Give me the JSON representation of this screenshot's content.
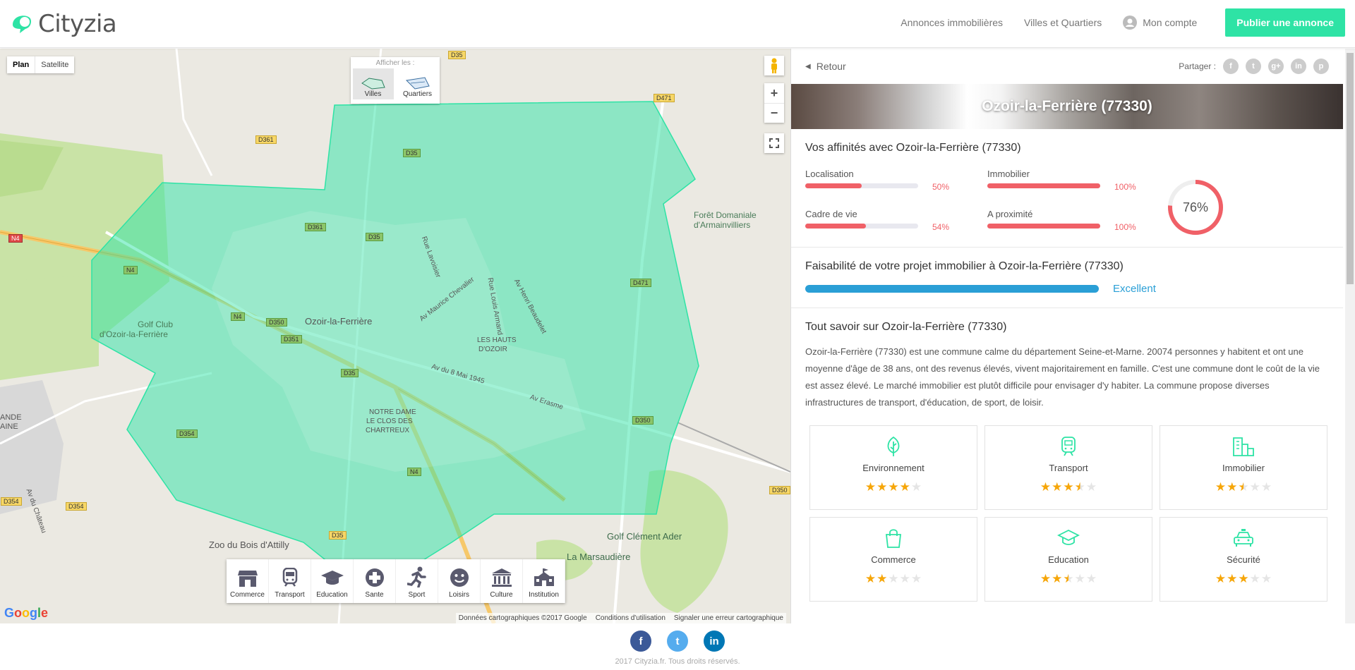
{
  "header": {
    "brand": "Cityzia",
    "nav": [
      "Annonces immobilières",
      "Villes et Quartiers"
    ],
    "account": "Mon compte",
    "publish": "Publier une annonce"
  },
  "map": {
    "type_plan": "Plan",
    "type_satellite": "Satellite",
    "show_title": "Afficher les :",
    "show_villes": "Villes",
    "show_quartiers": "Quartiers",
    "labels": {
      "city": "Ozoir-la-Ferrière",
      "forest1": "Forêt Domaniale",
      "forest2": "d'Armainvilliers",
      "golf1a": "Golf Club",
      "golf1b": "d'Ozoir-la-Ferrière",
      "hauts1": "LES HAUTS",
      "hauts2": "D'OZOIR",
      "nd1": "NOTRE DAME",
      "nd2": "LE CLOS DES",
      "nd3": "CHARTREUX",
      "zoo": "Zoo du Bois d'Attilly",
      "golf2": "Golf Clément Ader",
      "marsaudiere": "La Marsaudière",
      "av8mai": "Av du 8 Mai 1945",
      "averasme": "Av Erasme",
      "avmaurice": "Av Maurice Chevalier",
      "avhenri": "Av Henri Beaudelet",
      "avlouis": "Rue Louis Armand",
      "avvictor": "Rue Lavoisier",
      "avchateau": "Av du Château",
      "ande": "ANDE",
      "aine": "AINE"
    },
    "roads": [
      "D35",
      "D361",
      "D471",
      "D35",
      "D361",
      "D35",
      "N4",
      "N4",
      "D350",
      "D351",
      "N4",
      "D471",
      "D35",
      "D354",
      "D354",
      "D354",
      "D350",
      "N4",
      "D35",
      "D350"
    ],
    "poi": [
      {
        "label": "Commerce",
        "icon": "shop-icon"
      },
      {
        "label": "Transport",
        "icon": "train-icon"
      },
      {
        "label": "Education",
        "icon": "graduation-cap-icon"
      },
      {
        "label": "Sante",
        "icon": "medical-cross-icon"
      },
      {
        "label": "Sport",
        "icon": "runner-icon"
      },
      {
        "label": "Loisirs",
        "icon": "smiley-icon"
      },
      {
        "label": "Culture",
        "icon": "museum-icon"
      },
      {
        "label": "Institution",
        "icon": "town-hall-icon"
      }
    ],
    "footer": [
      "Données cartographiques ©2017 Google",
      "Conditions d'utilisation",
      "Signaler une erreur cartographique"
    ],
    "google": "Google",
    "polygon_color": "#2ee3a5"
  },
  "panel": {
    "back": "Retour",
    "share": "Partager :",
    "share_icons": [
      "facebook-icon",
      "twitter-icon",
      "google-plus-icon",
      "linkedin-icon",
      "pinterest-icon"
    ],
    "banner_title": "Ozoir-la-Ferrière (77330)",
    "affinities": {
      "title": "Vos affinités avec Ozoir-la-Ferrière (77330)",
      "items": [
        {
          "label": "Localisation",
          "pct": "50%",
          "value": 50
        },
        {
          "label": "Immobilier",
          "pct": "100%",
          "value": 100
        },
        {
          "label": "Cadre de vie",
          "pct": "54%",
          "value": 54
        },
        {
          "label": "A proximité",
          "pct": "100%",
          "value": 100
        }
      ],
      "total": "76%",
      "total_value": 76,
      "color": "#f06067"
    },
    "feasibility": {
      "title": "Faisabilité de votre projet immobilier à Ozoir-la-Ferrière (77330)",
      "value": "Excellent",
      "color": "#2a9fd6"
    },
    "about": {
      "title": "Tout savoir sur Ozoir-la-Ferrière (77330)",
      "text": "Ozoir-la-Ferrière (77330) est une commune calme du département Seine-et-Marne. 20074 personnes y habitent et ont une moyenne d'âge de 38 ans, ont des revenus élevés, vivent majoritairement en famille. C'est une commune dont le coût de la vie est assez élevé. Le marché immobilier est plutôt difficile pour envisager d'y habiter. La commune propose diverses infrastructures de transport, d'éducation, de sport, de loisir."
    },
    "cards": [
      {
        "title": "Environnement",
        "icon": "leaf-icon",
        "stars": 4
      },
      {
        "title": "Transport",
        "icon": "train-icon",
        "stars": 3.5
      },
      {
        "title": "Immobilier",
        "icon": "buildings-icon",
        "stars": 2.5
      },
      {
        "title": "Commerce",
        "icon": "shopping-bag-icon",
        "stars": 2
      },
      {
        "title": "Education",
        "icon": "graduation-cap-icon",
        "stars": 2.5
      },
      {
        "title": "Sécurité",
        "icon": "police-car-icon",
        "stars": 3
      }
    ],
    "accent": "#2ee3a5"
  },
  "footer": {
    "copy": "2017 Cityzia.fr. Tous droits réservés.",
    "socials": [
      {
        "name": "facebook-icon",
        "glyph": "f",
        "color": "#3b5998"
      },
      {
        "name": "twitter-icon",
        "glyph": "t",
        "color": "#55acee"
      },
      {
        "name": "linkedin-icon",
        "glyph": "in",
        "color": "#0077b5"
      }
    ]
  }
}
